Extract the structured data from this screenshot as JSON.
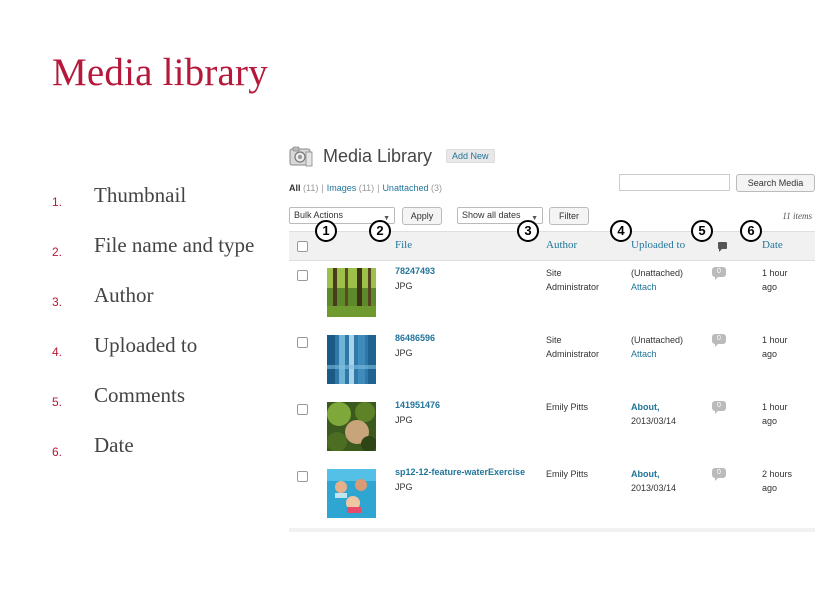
{
  "slide": {
    "title": "Media library",
    "legend": [
      {
        "num": "1.",
        "label": "Thumbnail"
      },
      {
        "num": "2.",
        "label": "File name and type"
      },
      {
        "num": "3.",
        "label": "Author"
      },
      {
        "num": "4.",
        "label": "Uploaded to"
      },
      {
        "num": "5.",
        "label": "Comments"
      },
      {
        "num": "6.",
        "label": "Date"
      }
    ],
    "markers": [
      "1",
      "2",
      "3",
      "4",
      "5",
      "6"
    ]
  },
  "screen": {
    "title": "Media Library",
    "add_new": "Add New",
    "views": {
      "all": "All",
      "all_count": "(11)",
      "images": "Images",
      "images_count": "(11)",
      "unattached": "Unattached",
      "unattached_count": "(3)",
      "separator": "|"
    },
    "search_button": "Search Media",
    "search_value": "",
    "bulk_actions": "Bulk Actions",
    "apply": "Apply",
    "dates_filter": "Show all dates",
    "filter": "Filter",
    "items_count": "11 items",
    "columns": {
      "file": "File",
      "author": "Author",
      "uploaded_to": "Uploaded to",
      "date": "Date"
    },
    "rows": [
      {
        "file": "78247493",
        "type": "JPG",
        "author_line1": "Site",
        "author_line2": "Administrator",
        "upload_line1": "(Unattached)",
        "upload_line2": "Attach",
        "comments": "0",
        "date_line1": "1 hour",
        "date_line2": "ago"
      },
      {
        "file": "86486596",
        "type": "JPG",
        "author_line1": "Site",
        "author_line2": "Administrator",
        "upload_line1": "(Unattached)",
        "upload_line2": "Attach",
        "comments": "0",
        "date_line1": "1 hour",
        "date_line2": "ago"
      },
      {
        "file": "141951476",
        "type": "JPG",
        "author_line1": "Emily Pitts",
        "author_line2": "",
        "upload_line1": "About,",
        "upload_line2": "2013/03/14",
        "comments": "0",
        "date_line1": "1 hour",
        "date_line2": "ago"
      },
      {
        "file": "sp12-12-feature-waterExercise",
        "type": "JPG",
        "author_line1": "Emily Pitts",
        "author_line2": "",
        "upload_line1": "About,",
        "upload_line2": "2013/03/14",
        "comments": "0",
        "date_line1": "2 hours",
        "date_line2": "ago"
      }
    ]
  },
  "colors": {
    "title_red": "#b5183a",
    "wp_link": "#21759b",
    "header_bg": "#f1f1f1"
  },
  "icons": [
    "media-library-icon",
    "comment-bubble-icon",
    "dropdown-caret-icon"
  ]
}
